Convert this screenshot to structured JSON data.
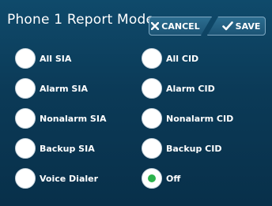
{
  "header": {
    "title": "Phone 1 Report Mode",
    "cancel_label": "CANCEL",
    "save_label": "SAVE"
  },
  "options": {
    "left": [
      {
        "label": "All SIA",
        "selected": false
      },
      {
        "label": "Alarm SIA",
        "selected": false
      },
      {
        "label": "Nonalarm SIA",
        "selected": false
      },
      {
        "label": "Backup SIA",
        "selected": false
      },
      {
        "label": "Voice Dialer",
        "selected": false
      }
    ],
    "right": [
      {
        "label": "All CID",
        "selected": false
      },
      {
        "label": "Alarm CID",
        "selected": false
      },
      {
        "label": "Nonalarm CID",
        "selected": false
      },
      {
        "label": "Backup CID",
        "selected": false
      },
      {
        "label": "Off",
        "selected": true
      }
    ]
  },
  "colors": {
    "background": "#0b3a57",
    "selected_dot": "#2bb24c",
    "text": "#ffffff"
  },
  "icons": {
    "cancel": "x-icon",
    "save": "checkmark-icon"
  }
}
